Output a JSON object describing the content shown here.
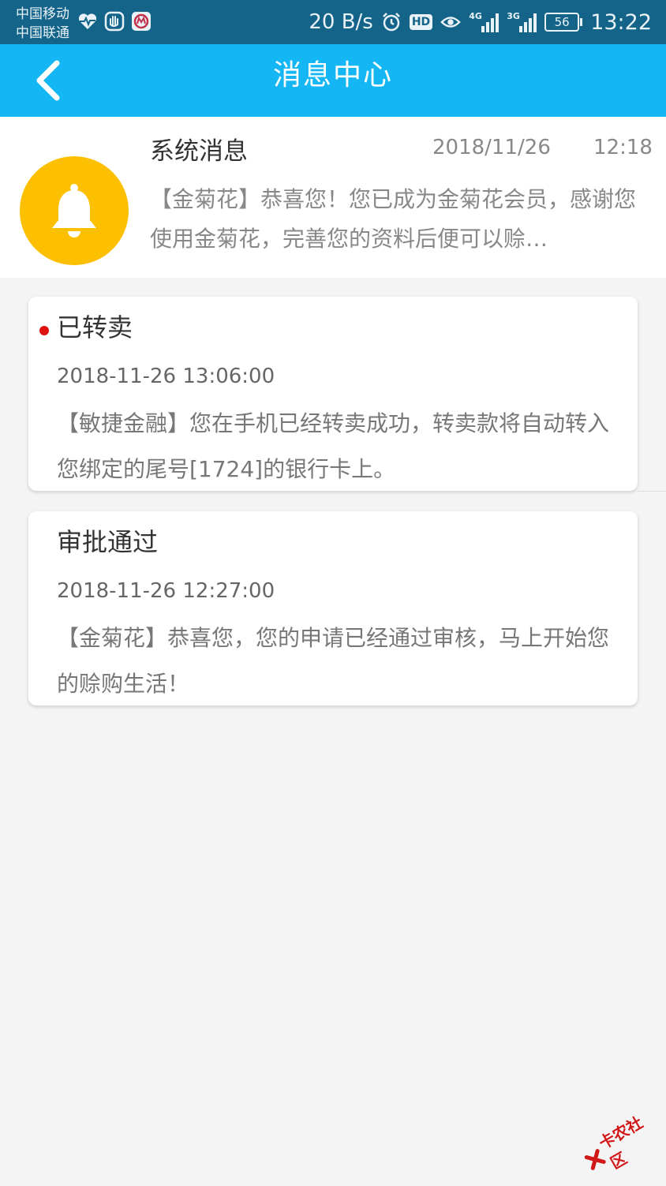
{
  "status_bar": {
    "carrier1": "中国移动",
    "carrier2": "中国联通",
    "net_speed": "20 B/s",
    "hd_label": "HD",
    "network1": "4G",
    "network2": "3G",
    "battery_level": "56",
    "time": "13:22",
    "icons": [
      "heart-rate-icon",
      "hand-icon",
      "bank-logo-icon",
      "alarm-icon",
      "eye-icon"
    ],
    "background_color": "#14648a"
  },
  "header": {
    "title": "消息中心",
    "back_icon": "chevron-left-icon",
    "background_color": "#14b6f4"
  },
  "system_message": {
    "title": "系统消息",
    "date": "2018/11/26",
    "time": "12:18",
    "preview": "【金菊花】恭喜您！您已成为金菊花会员，感谢您使用金菊花，完善您的资料后便可以赊…",
    "avatar_icon": "bell-icon",
    "avatar_color": "#fcc000"
  },
  "messages": [
    {
      "title": "已转卖",
      "unread": true,
      "time": "2018-11-26 13:06:00",
      "body": "【敏捷金融】您在手机已经转卖成功，转卖款将自动转入您绑定的尾号[1724]的银行卡上。"
    },
    {
      "title": "审批通过",
      "unread": false,
      "time": "2018-11-26 12:27:00",
      "body": "【金菊花】恭喜您，您的申请已经通过审核，马上开始您的赊购生活！"
    }
  ],
  "watermark": {
    "text": "卡农社区",
    "color": "#d01818"
  }
}
